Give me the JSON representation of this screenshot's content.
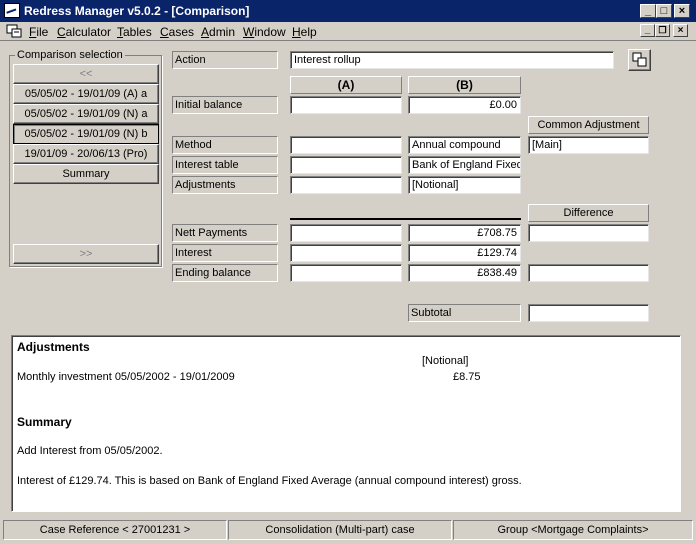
{
  "window": {
    "title": "Redress Manager v5.0.2 - [Comparison]"
  },
  "menu": [
    "File",
    "Calculator",
    "Tables",
    "Cases",
    "Admin",
    "Window",
    "Help"
  ],
  "selection": {
    "label": "Comparison selection",
    "prev_button": "<<",
    "next_button": ">>",
    "items": [
      "05/05/02 - 19/01/09 (A) a",
      "05/05/02 - 19/01/09 (N) a",
      "05/05/02 - 19/01/09 (N) b",
      "19/01/09 - 20/06/13 (Pro)",
      "Summary"
    ]
  },
  "form": {
    "action_label": "Action",
    "action_value": "Interest rollup",
    "col_a": "(A)",
    "col_b": "(B)",
    "common_adjustment": "Common Adjustment",
    "difference": "Difference",
    "initial_balance_label": "Initial balance",
    "initial_balance_a": "",
    "initial_balance_b": "£0.00",
    "method_label": "Method",
    "method_b": "Annual compound",
    "method_common": "[Main]",
    "interest_table_label": "Interest table",
    "interest_table_b": "Bank of England Fixed",
    "adjustments_label": "Adjustments",
    "adjustments_b": "[Notional]",
    "nett_payments_label": "Nett Payments",
    "nett_payments_b": "£708.75",
    "interest_label": "Interest",
    "interest_b": "£129.74",
    "ending_balance_label": "Ending balance",
    "ending_balance_b": "£838.49",
    "subtotal_label": "Subtotal"
  },
  "report": {
    "adjustments_heading": "Adjustments",
    "notional_header": "[Notional]",
    "monthly_label": "Monthly investment 05/05/2002 - 19/01/2009",
    "monthly_value": "£8.75",
    "summary_heading": "Summary",
    "summary_line1": "Add Interest from 05/05/2002.",
    "summary_line2": "Interest of £129.74. This is based on Bank of England Fixed Average (annual compound interest) gross."
  },
  "status": {
    "case_reference": "Case Reference < 27001231 >",
    "consolidation": "Consolidation (Multi-part) case",
    "group": "Group <Mortgage Complaints>"
  }
}
